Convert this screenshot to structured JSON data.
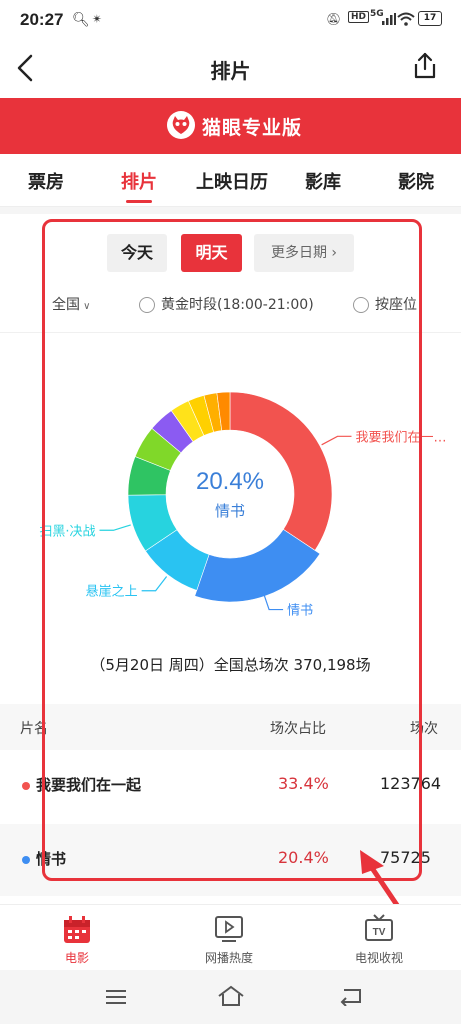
{
  "status_bar": {
    "time": "20:27",
    "icons": [
      "search-icon",
      "notification-icon",
      "mute-icon",
      "hd-icon",
      "5g-signal-icon",
      "wifi-icon"
    ],
    "hd": "HD",
    "network": "5G",
    "battery": "17"
  },
  "nav": {
    "title": "排片",
    "back_icon": "back-arrow-icon",
    "share_icon": "share-icon"
  },
  "banner": {
    "brand": "猫眼专业版",
    "color": "#e8333b"
  },
  "tabs": [
    {
      "label": "票房",
      "active": false
    },
    {
      "label": "排片",
      "active": true
    },
    {
      "label": "上映日历",
      "active": false
    },
    {
      "label": "影库",
      "active": false
    },
    {
      "label": "影院",
      "active": false
    }
  ],
  "date_buttons": {
    "today": "今天",
    "tomorrow": "明天",
    "more": "更多日期"
  },
  "filters": {
    "region": "全国",
    "golden_time": "黄金时段(18:00-21:00)",
    "by_seat": "按座位"
  },
  "chart_data": {
    "type": "pie",
    "center_value": "20.4%",
    "center_label": "情书",
    "slices": [
      {
        "name": "我要我们在一起",
        "label": "我要我们在一…",
        "value": 33.4,
        "color": "#f2534f"
      },
      {
        "name": "情书",
        "label": "情书",
        "value": 20.4,
        "color": "#3e8ef2"
      },
      {
        "name": "悬崖之上",
        "label": "悬崖之上",
        "value": 10.0,
        "color": "#29c3f2"
      },
      {
        "name": "扫黑·决战",
        "label": "扫黑·决战",
        "value": 9.0,
        "color": "#27d3df"
      },
      {
        "value": 6.0,
        "color": "#2fc463"
      },
      {
        "value": 5.0,
        "color": "#80d829"
      },
      {
        "value": 4.0,
        "color": "#8b5bf2"
      },
      {
        "value": 3.0,
        "color": "#ffe21a"
      },
      {
        "value": 2.5,
        "color": "#ffd000"
      },
      {
        "value": 2.0,
        "color": "#ffaf00"
      },
      {
        "value": 2.0,
        "color": "#ff8a00"
      }
    ]
  },
  "summary": "（5月20日 周四）全国总场次 370,198场",
  "table": {
    "headers": [
      "片名",
      "场次占比",
      "场次"
    ],
    "rows": [
      {
        "name": "我要我们在一起",
        "pct": "33.4%",
        "count": "123764",
        "dot": "#f2534f"
      },
      {
        "name": "情书",
        "pct": "20.4%",
        "count": "75725",
        "dot": "#3e8ef2"
      }
    ]
  },
  "bottom_nav": [
    {
      "label": "电影",
      "icon": "calendar-icon",
      "active": true
    },
    {
      "label": "网播热度",
      "icon": "play-icon",
      "active": false
    },
    {
      "label": "电视收视",
      "icon": "tv-icon",
      "active": false
    }
  ],
  "system_nav": [
    "menu-icon",
    "home-icon",
    "back-icon"
  ]
}
